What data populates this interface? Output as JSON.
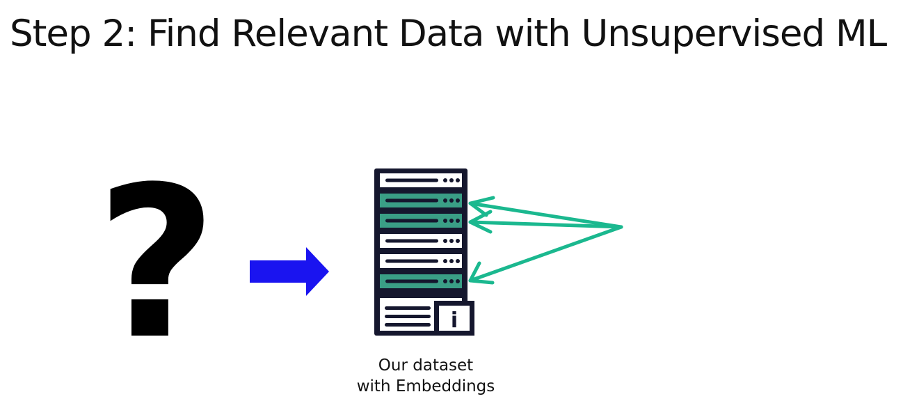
{
  "slide": {
    "title": "Step 2: Find Relevant Data with Unsupervised ML"
  },
  "diagram": {
    "question_mark": "?",
    "caption_line1": "Our dataset",
    "caption_line2": "with Embeddings",
    "info_glyph": "i",
    "rows": [
      {
        "highlighted": false
      },
      {
        "highlighted": true
      },
      {
        "highlighted": true
      },
      {
        "highlighted": false
      },
      {
        "highlighted": false
      },
      {
        "highlighted": true
      }
    ],
    "colors": {
      "dark": "#15172e",
      "highlight": "#3a9e86",
      "connector": "#1bb88f",
      "flow_arrow": "#1a14f0",
      "text": "#111111"
    },
    "icons": [
      "question-mark-icon",
      "right-arrow-icon",
      "database-server-icon",
      "info-icon",
      "pointer-arrow-icon"
    ]
  }
}
